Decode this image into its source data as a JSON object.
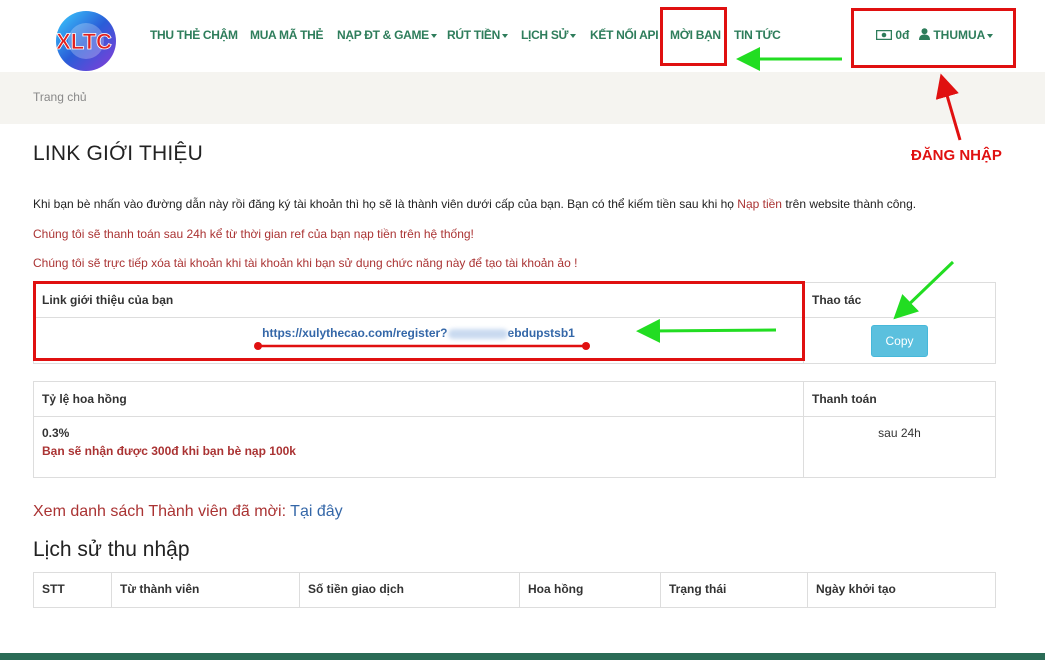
{
  "header": {
    "logo_text": "XLTC",
    "nav": [
      {
        "label": "THU THẺ CHẬM",
        "dropdown": false
      },
      {
        "label": "MUA MÃ THẺ",
        "dropdown": false
      },
      {
        "label": "NẠP ĐT & GAME",
        "dropdown": true
      },
      {
        "label": "RÚT TIỀN",
        "dropdown": true
      },
      {
        "label": "LỊCH SỬ",
        "dropdown": true
      },
      {
        "label": "KẾT NỐI API",
        "dropdown": false
      },
      {
        "label": "MỜI BẠN",
        "dropdown": false
      },
      {
        "label": "TIN TỨC",
        "dropdown": false
      }
    ],
    "balance": "0đ",
    "username": "THUMUA"
  },
  "breadcrumb": {
    "home": "Trang chủ"
  },
  "page": {
    "title": "LINK GIỚI THIỆU",
    "intro_before": "Khi bạn bè nhấn vào đường dẫn này rồi đăng ký tài khoản thì họ sẽ là thành viên dưới cấp của bạn. Bạn có thể kiếm tiền sau khi họ ",
    "intro_link": "Nạp tiền",
    "intro_after": " trên website thành công.",
    "notice_1": "Chúng tôi sẽ thanh toán sau 24h kể từ thời gian ref của bạn nạp tiền trên hệ thống!",
    "notice_2": "Chúng tôi sẽ trực tiếp xóa tài khoản khi tài khoản khi bạn sử dụng chức năng này để tạo tài khoản ảo !"
  },
  "link_table": {
    "col_link": "Link giới thiệu của bạn",
    "col_action": "Thao tác",
    "link_prefix": "https://xulythecao.com/register?",
    "link_suffix": "ebdupstsb1",
    "copy_label": "Copy"
  },
  "commission_table": {
    "col_rate": "Tỷ lệ hoa hồng",
    "col_payment": "Thanh toán",
    "rate": "0.3%",
    "rate_note": "Bạn sẽ nhận được 300đ khi bạn bè nạp 100k",
    "payment": "sau 24h"
  },
  "invite": {
    "text": "Xem danh sách Thành viên đã mời: ",
    "link": "Tại đây"
  },
  "history": {
    "title": "Lịch sử thu nhập",
    "columns": [
      "STT",
      "Từ thành viên",
      "Số tiền giao dịch",
      "Hoa hồng",
      "Trạng thái",
      "Ngày khởi tạo"
    ]
  },
  "annotations": {
    "login_label": "ĐĂNG NHẬP"
  },
  "colors": {
    "nav_green": "#2e7d5b",
    "alert_red": "#a33",
    "link_blue": "#3467a8",
    "copy_button": "#5bc0de",
    "annotation_red": "#e01010",
    "annotation_green": "#22dd22"
  }
}
